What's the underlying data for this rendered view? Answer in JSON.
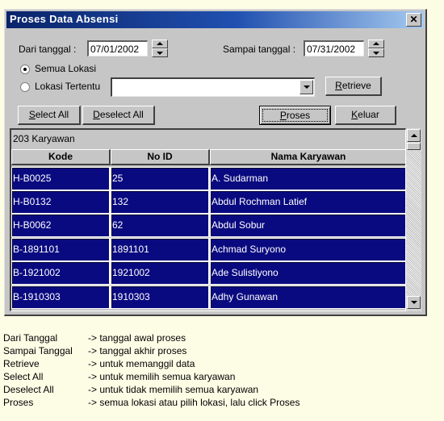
{
  "window": {
    "title": "Proses Data Absensi",
    "close_glyph": "✕"
  },
  "form": {
    "from_label": "Dari tanggal :",
    "from_value": "07/01/2002",
    "to_label": "Sampai tanggal :",
    "to_value": "07/31/2002",
    "radio_all_label": "Semua Lokasi",
    "radio_all_checked": true,
    "radio_specific_label": "Lokasi Tertentu",
    "radio_specific_checked": false,
    "location_value": ""
  },
  "buttons": {
    "retrieve": {
      "mnemonic": "R",
      "rest": "etrieve"
    },
    "select_all": {
      "pre": "S",
      "rest": "elect All"
    },
    "deselect_all": {
      "pre": "D",
      "rest": "eselect All"
    },
    "proses": {
      "pre": "P",
      "rest": "roses"
    },
    "keluar": {
      "pre": "K",
      "rest": "eluar"
    }
  },
  "grid": {
    "caption": "203 Karyawan",
    "columns": [
      "Kode",
      "No ID",
      "Nama Karyawan"
    ],
    "selection_color": "#0a0a80",
    "rows": [
      {
        "kode": "H-B0025",
        "no_id": "25",
        "nama": "A. Sudarman"
      },
      {
        "kode": "H-B0132",
        "no_id": "132",
        "nama": "Abdul Rochman Latief"
      },
      {
        "kode": "H-B0062",
        "no_id": "62",
        "nama": "Abdul Sobur"
      },
      {
        "kode": "B-1891101",
        "no_id": "1891101",
        "nama": "Achmad Suryono"
      },
      {
        "kode": "B-1921002",
        "no_id": "1921002",
        "nama": "Ade Sulistiyono"
      },
      {
        "kode": "B-1910303",
        "no_id": "1910303",
        "nama": "Adhy Gunawan"
      }
    ]
  },
  "legend": [
    {
      "key": "Dari Tanggal",
      "desc": "-> tanggal awal proses"
    },
    {
      "key": "Sampai Tanggal",
      "desc": "-> tanggal akhir proses"
    },
    {
      "key": "Retrieve",
      "desc": "-> untuk memanggil data"
    },
    {
      "key": "Select All",
      "desc": "-> untuk memilih semua karyawan"
    },
    {
      "key": "Deselect All",
      "desc": "-> untuk tidak memilih semua karyawan"
    },
    {
      "key": "Proses",
      "desc": "-> semua lokasi atau pilih lokasi, lalu click Proses"
    }
  ]
}
